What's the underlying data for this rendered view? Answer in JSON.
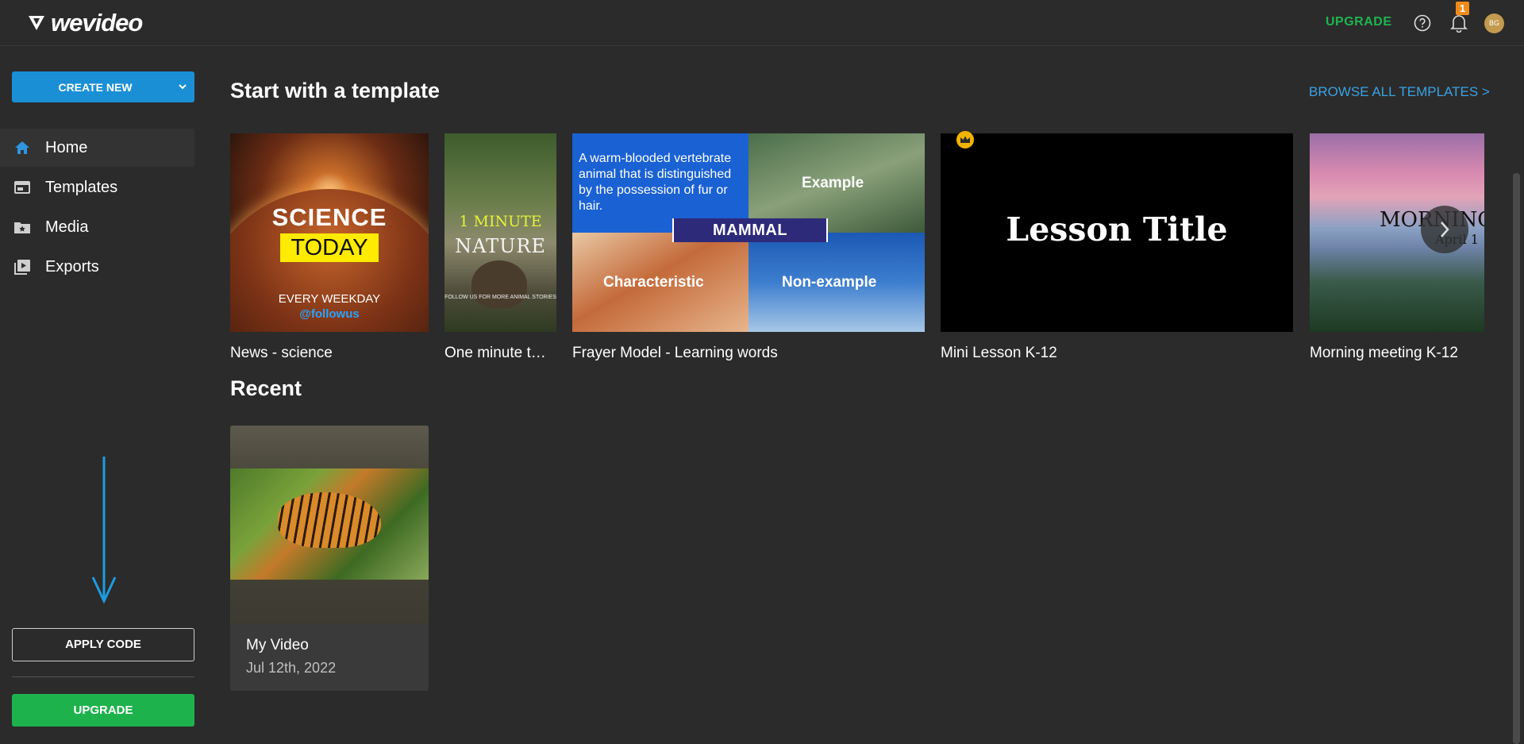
{
  "header": {
    "logo_text": "wevideo",
    "upgrade_label": "UPGRADE",
    "notification_count": "1",
    "avatar_initials": "BG"
  },
  "sidebar": {
    "create_label": "CREATE NEW",
    "items": [
      {
        "label": "Home",
        "icon": "home-icon"
      },
      {
        "label": "Templates",
        "icon": "templates-icon"
      },
      {
        "label": "Media",
        "icon": "media-icon"
      },
      {
        "label": "Exports",
        "icon": "exports-icon"
      }
    ],
    "apply_code_label": "APPLY CODE",
    "upgrade_label": "UPGRADE"
  },
  "main": {
    "templates_title": "Start with a template",
    "browse_label": "BROWSE ALL TEMPLATES >",
    "templates": [
      {
        "caption": "News - science",
        "thumb_lines": [
          "SCIENCE",
          "TODAY",
          "EVERY WEEKDAY",
          "@followus"
        ]
      },
      {
        "caption": "One minute t…",
        "thumb_lines": [
          "1 MINUTE",
          "NATURE",
          "FOLLOW US FOR MORE ANIMAL STORIES"
        ]
      },
      {
        "caption": "Frayer Model - Learning words",
        "thumb_lines": [
          "A warm-blooded vertebrate animal that is distinguished by the possession of fur or hair.",
          "Example",
          "MAMMAL",
          "Characteristic",
          "Non-example"
        ]
      },
      {
        "caption": "Mini Lesson K-12",
        "thumb_lines": [
          "Lesson Title"
        ]
      },
      {
        "caption": "Morning meeting K-12",
        "thumb_lines": [
          "MORNING",
          "April 1"
        ]
      }
    ],
    "recent_title": "Recent",
    "recent": [
      {
        "name": "My Video",
        "date": "Jul 12th, 2022"
      }
    ]
  },
  "colors": {
    "background": "#2b2b2b",
    "accent_blue": "#1a8fd6",
    "upgrade_green": "#1db24c",
    "link_blue": "#3aa2e4",
    "badge_orange": "#f08b1a"
  }
}
